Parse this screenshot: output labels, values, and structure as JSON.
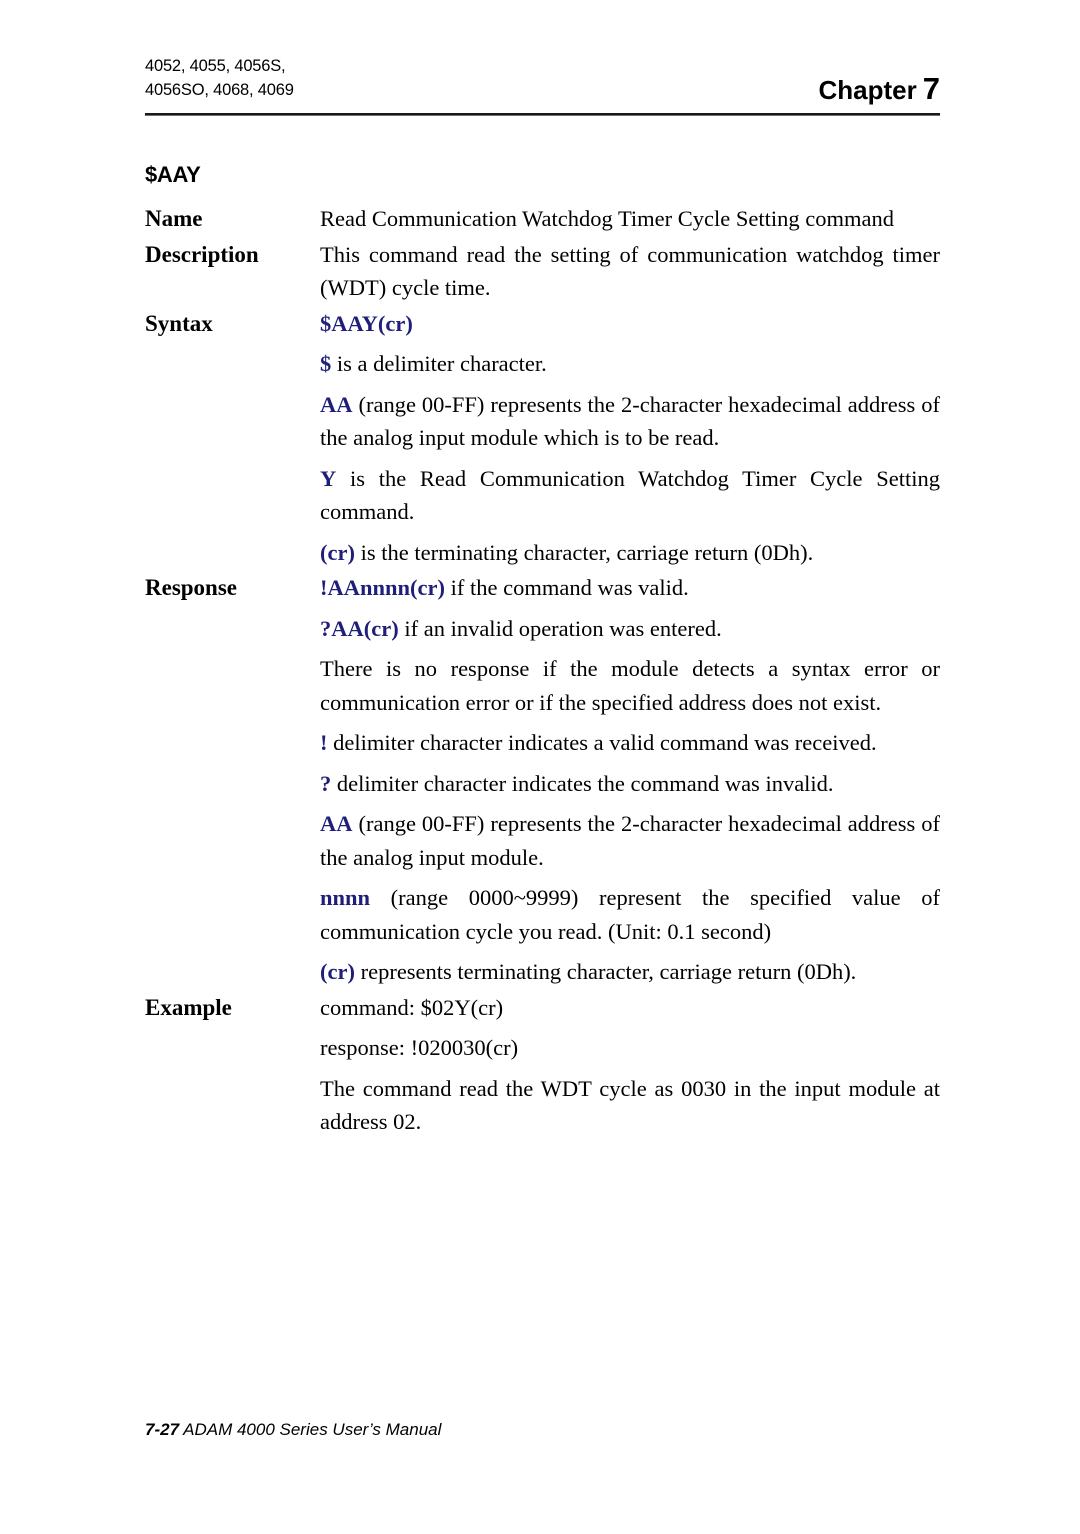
{
  "header": {
    "modules_line1": "4052, 4055, 4056S,",
    "modules_line2": "4056SO, 4068, 4069",
    "chapter_label": "Chapter",
    "chapter_number": "7"
  },
  "command": {
    "title": "$AAY",
    "labels": {
      "name": "Name",
      "description": "Description",
      "syntax": "Syntax",
      "response": "Response",
      "example": "Example"
    },
    "name_text": "Read Communication Watchdog Timer Cycle Setting command",
    "description_text": "This command read the setting of communication watchdog timer (WDT) cycle time.",
    "syntax_code": "$AAY(cr)",
    "syntax_items": [
      {
        "token": "$",
        "text": " is a delimiter character."
      },
      {
        "token": "AA",
        "text": " (range 00-FF) represents the 2-character hexadecimal address of the analog input module which is to be read."
      },
      {
        "token": "Y",
        "text": " is the Read Communication Watchdog Timer Cycle Setting command."
      },
      {
        "token": "(cr)",
        "text": " is the terminating character, carriage return (0Dh)."
      }
    ],
    "response_items": [
      {
        "token": "!AAnnnn(cr)",
        "text": " if the command was valid."
      },
      {
        "token": "?AA(cr)",
        "text": " if an invalid operation was entered."
      },
      {
        "token": "",
        "text": "There is no response if the module detects a syntax error or communication error or if the specified address does not exist."
      },
      {
        "token": "!",
        "text": " delimiter character indicates a valid command was received."
      },
      {
        "token": "?",
        "text": " delimiter character indicates the command was invalid."
      },
      {
        "token": "AA",
        "text": " (range 00-FF) represents the 2-character hexadecimal address of the analog input module."
      },
      {
        "token": "nnnn",
        "text": " (range 0000~9999) represent the specified value of communication cycle you read. (Unit: 0.1 second)"
      },
      {
        "token": "(cr)",
        "text": " represents terminating character, carriage return (0Dh)."
      }
    ],
    "example_items": [
      "command: $02Y(cr)",
      "response: !020030(cr)",
      "The command read the WDT cycle as 0030 in the input module at address 02."
    ]
  },
  "footer": {
    "page_number": "7-27",
    "text": "ADAM 4000 Series User’s Manual"
  },
  "colors": {
    "token_blue": "#1f1f7a",
    "text_black": "#000000",
    "rule_dark": "#1a1a1a",
    "rule_light": "#6e6e6e"
  }
}
